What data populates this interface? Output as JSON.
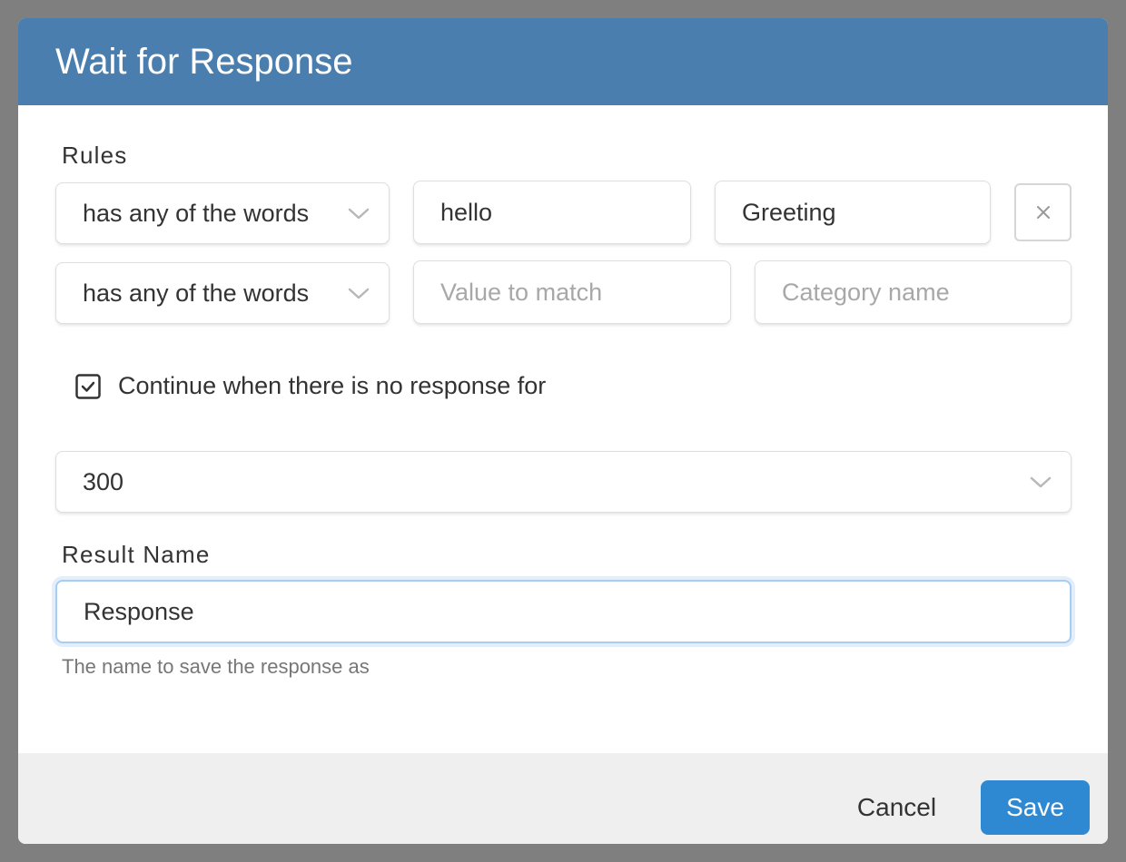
{
  "dialog": {
    "title": "Wait for Response"
  },
  "rules": {
    "label": "Rules",
    "rows": [
      {
        "operator": "has any of the words",
        "value": "hello",
        "category": "Greeting",
        "remove_icon": "close-icon"
      },
      {
        "operator": "has any of the words",
        "value_placeholder": "Value to match",
        "category_placeholder": "Category name"
      }
    ]
  },
  "timeout": {
    "checkbox_checked": true,
    "checkbox_label": "Continue when there is no response for",
    "selected_value": "300"
  },
  "result_name": {
    "label": "Result Name",
    "value": "Response",
    "help": "The name to save the response as"
  },
  "footer": {
    "cancel_label": "Cancel",
    "save_label": "Save"
  },
  "colors": {
    "header": "#4a7eaf",
    "primary_button": "#2f89d2",
    "footer_bg": "#efefef"
  }
}
